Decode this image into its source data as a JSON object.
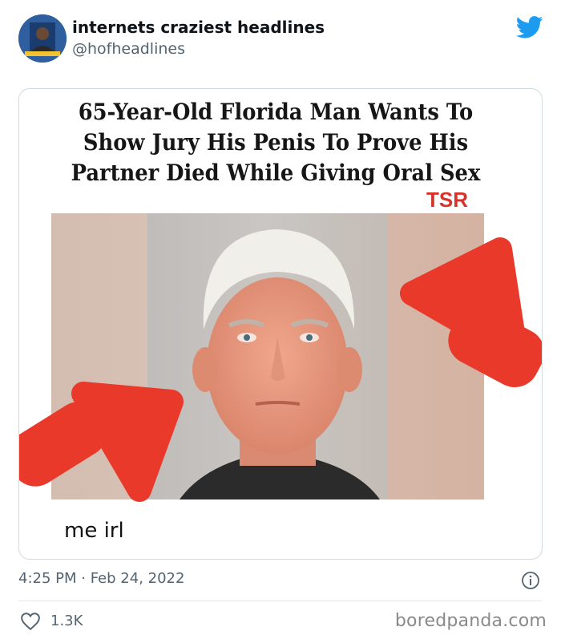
{
  "tweet": {
    "display_name": "internets craziest headlines",
    "handle": "@hofheadlines",
    "platform_icon": "twitter-bird-icon",
    "caption": "me irl",
    "timestamp": "4:25 PM · Feb 24, 2022",
    "likes": "1.3K"
  },
  "meme": {
    "headline_lines": [
      "65-Year-Old Florida Man Wants To",
      "Show Jury His Penis To Prove His",
      "Partner Died While Giving Oral Sex"
    ],
    "source_logo": "TSR",
    "arrow_color": "#e8392b"
  },
  "footer": {
    "watermark": "boredpanda.com"
  },
  "colors": {
    "twitter_blue": "#1d9bf0",
    "secondary_text": "#536471",
    "border": "#cfd9de"
  }
}
